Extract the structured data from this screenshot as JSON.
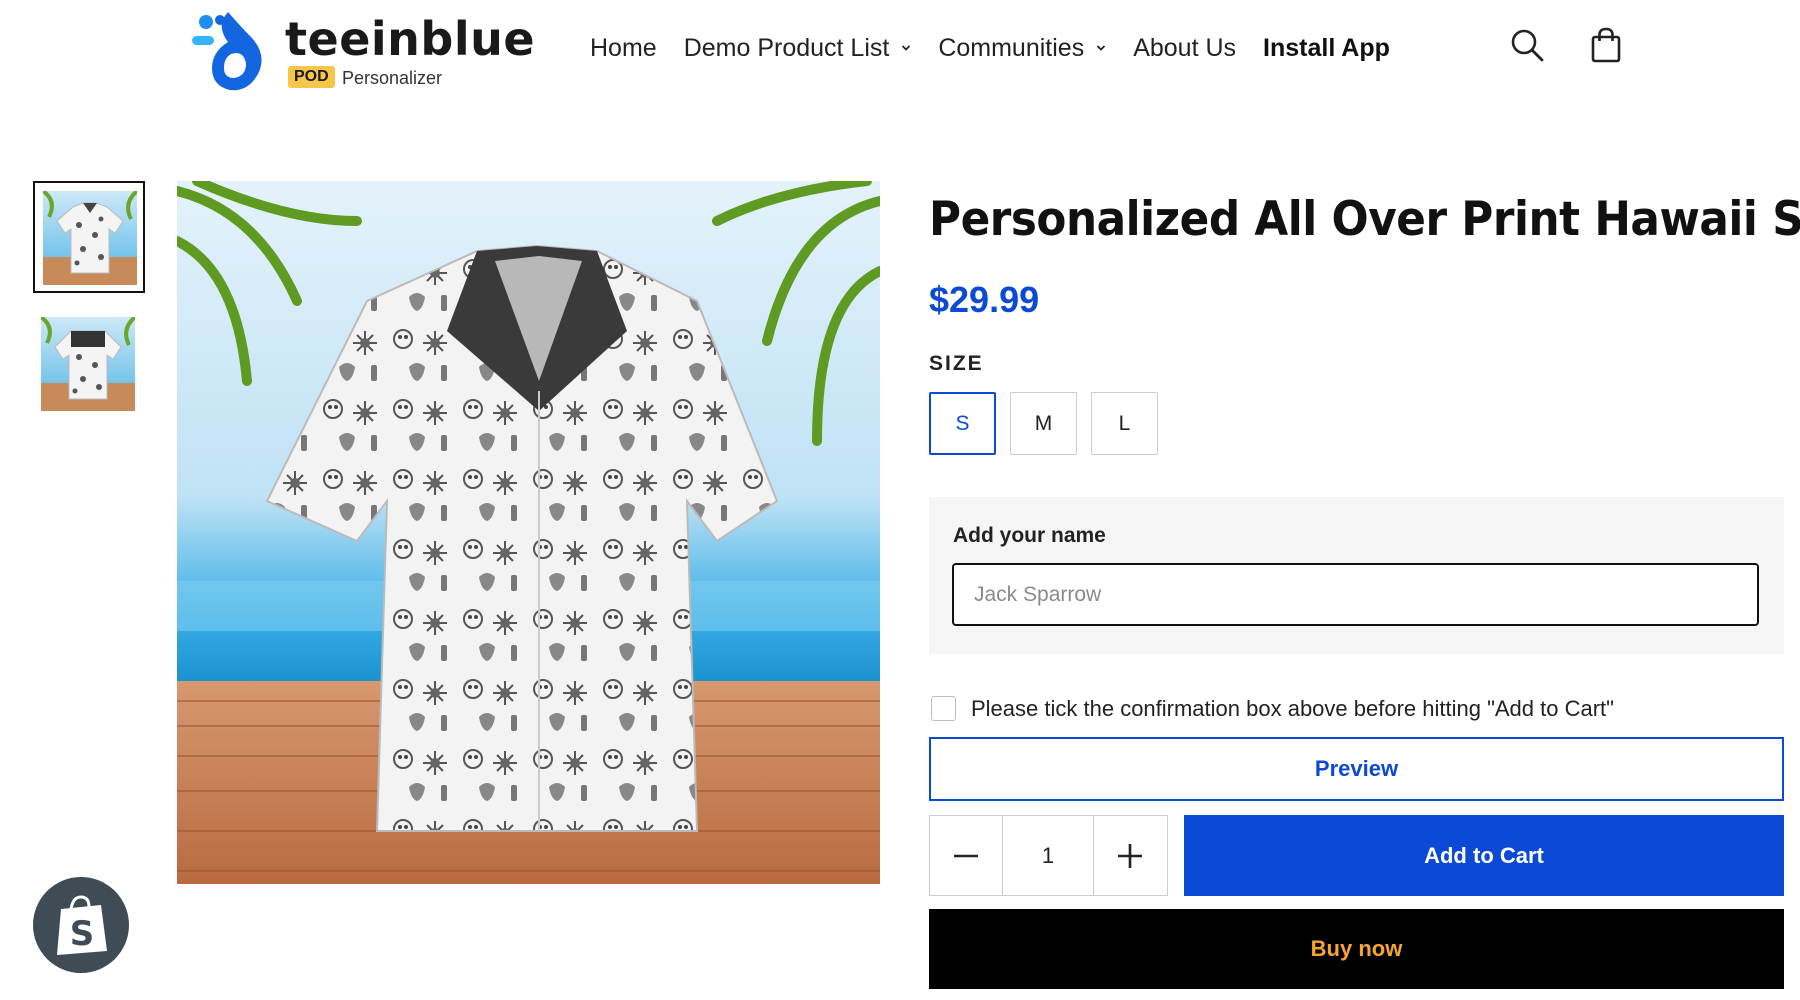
{
  "brand": {
    "name": "teeinblue",
    "badge": "POD",
    "sub": "Personalizer",
    "colors": {
      "primary": "#0b49d6",
      "badge": "#f6c64a"
    }
  },
  "nav": {
    "items": [
      {
        "label": "Home",
        "has_dropdown": false
      },
      {
        "label": "Demo Product List",
        "has_dropdown": true
      },
      {
        "label": "Communities",
        "has_dropdown": true
      },
      {
        "label": "About Us",
        "has_dropdown": false
      },
      {
        "label": "Install App",
        "has_dropdown": false,
        "bold": true
      }
    ],
    "icons": [
      "search-icon",
      "shopping-bag-icon"
    ]
  },
  "gallery": {
    "thumbnails": [
      "shirt-front-thumbnail",
      "shirt-back-thumbnail"
    ],
    "selected_index": 0,
    "main_image": "hawaii-shirt-on-beach-deck"
  },
  "product": {
    "title": "Personalized All Over Print Hawaii Shirt",
    "price": "$29.99",
    "size_label": "SIZE",
    "sizes": [
      "S",
      "M",
      "L"
    ],
    "selected_size": "S",
    "personalize_label": "Add your name",
    "name_placeholder": "Jack Sparrow",
    "confirm_text": "Please tick the confirmation box above before hitting \"Add to Cart\"",
    "confirm_checked": false,
    "preview_label": "Preview",
    "quantity": "1",
    "add_to_cart_label": "Add to Cart",
    "buy_now_label": "Buy now"
  },
  "colors": {
    "accent": "#0b49d6",
    "buy_now_bg": "#000000",
    "buy_now_text": "#f6a530"
  }
}
